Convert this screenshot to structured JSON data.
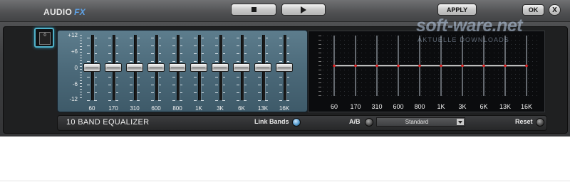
{
  "window": {
    "title_prefix": "AUDIO",
    "title_suffix": "FX",
    "apply_label": "APPLY",
    "ok_label": "OK",
    "close_label": "X"
  },
  "watermark": {
    "main": "soft-ware.net",
    "sub": "AKTUELLE DOWNLOADS"
  },
  "preset_icon_text": "0",
  "equalizer": {
    "title": "10 BAND EQUALIZER",
    "db_labels": [
      "+12",
      "+6",
      "0",
      "-6",
      "-12"
    ],
    "bands": [
      {
        "freq": "60",
        "gain": 0
      },
      {
        "freq": "170",
        "gain": 0
      },
      {
        "freq": "310",
        "gain": 0
      },
      {
        "freq": "600",
        "gain": 0
      },
      {
        "freq": "800",
        "gain": 0
      },
      {
        "freq": "1K",
        "gain": 0
      },
      {
        "freq": "3K",
        "gain": 0
      },
      {
        "freq": "6K",
        "gain": 0
      },
      {
        "freq": "13K",
        "gain": 0
      },
      {
        "freq": "16K",
        "gain": 0
      }
    ]
  },
  "controls": {
    "link_bands_label": "Link Bands",
    "ab_label": "A/B",
    "preset_value": "Standard",
    "reset_label": "Reset"
  },
  "colors": {
    "accent": "#5fa3e8",
    "eq_panel": "#4e6d7d",
    "curve": "#ffffff",
    "curve_points": "#e02020",
    "link_on": "#4b93c7"
  }
}
